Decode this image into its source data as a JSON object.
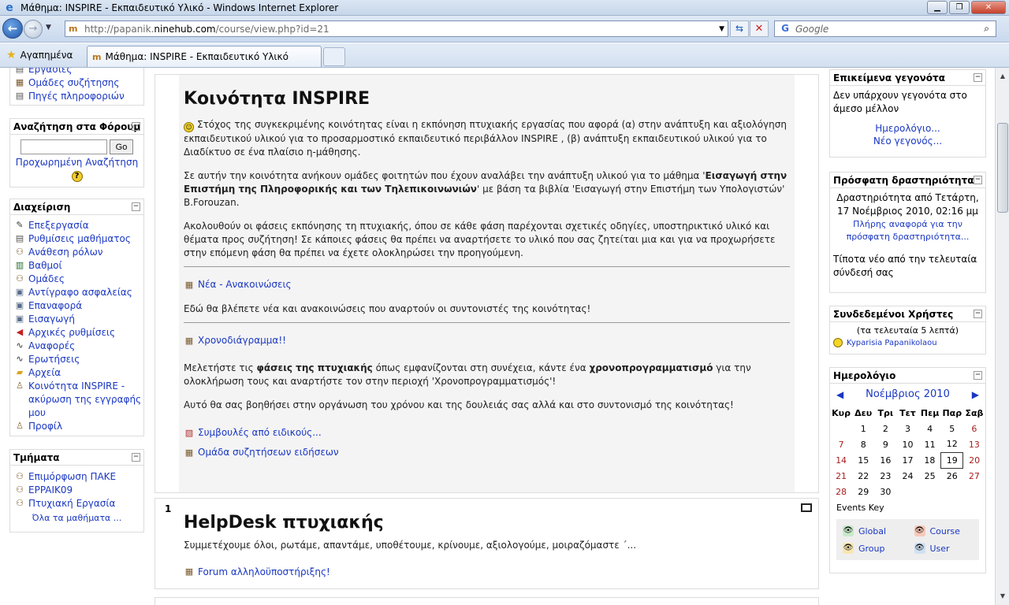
{
  "window": {
    "title": "Μάθημα: INSPIRE - Εκπαιδευτικό Υλικό - Windows Internet Explorer"
  },
  "browser": {
    "url_prefix": "http://papanik.",
    "url_domain": "ninehub.com",
    "url_path": "/course/view.php?id=21",
    "search_placeholder": "Google",
    "favorites_label": "Αγαπημένα",
    "tab_label": "Μάθημα: INSPIRE - Εκπαιδευτικό Υλικό"
  },
  "left": {
    "activities": [
      "Εργασίες",
      "Ομάδες συζήτησης",
      "Πηγές πληροφοριών"
    ],
    "forum_search": {
      "title": "Αναζήτηση στα Φόρουμ",
      "go": "Go",
      "advanced": "Προχωρημένη Αναζήτηση",
      "help": "?"
    },
    "admin": {
      "title": "Διαχείριση",
      "items": [
        {
          "label": "Επεξεργασία",
          "icon": "pencil"
        },
        {
          "label": "Ρυθμίσεις μαθήματος",
          "icon": "doc"
        },
        {
          "label": "Ανάθεση ρόλων",
          "icon": "people"
        },
        {
          "label": "Βαθμοί",
          "icon": "grade"
        },
        {
          "label": "Ομάδες",
          "icon": "people"
        },
        {
          "label": "Αντίγραφο ασφαλείας",
          "icon": "backup"
        },
        {
          "label": "Επαναφορά",
          "icon": "backup"
        },
        {
          "label": "Εισαγωγή",
          "icon": "backup"
        },
        {
          "label": "Αρχικές ρυθμίσεις",
          "icon": "red"
        },
        {
          "label": "Αναφορές",
          "icon": "chart"
        },
        {
          "label": "Ερωτήσεις",
          "icon": "chart"
        },
        {
          "label": "Αρχεία",
          "icon": "folder"
        },
        {
          "label": "Κοινότητα INSPIRE - ακύρωση της εγγραφής μου",
          "icon": "person"
        },
        {
          "label": "Προφίλ",
          "icon": "person"
        }
      ]
    },
    "sections": {
      "title": "Τμήματα",
      "items": [
        "Επιμόρφωση ΠΑΚΕ",
        "EPPAIK09",
        "Πτυχιακή Εργασία"
      ],
      "all": "Όλα τα μαθήματα ..."
    }
  },
  "main": {
    "title": "Κοινότητα INSPIRE",
    "p1": "Στόχος της συγκεκριμένης κοινότητας είναι η εκπόνηση πτυχιακής εργασίας που αφορά (α) στην ανάπτυξη και αξιολόγηση εκπαιδευτικού υλικού για το προσαρμοστικό εκπαιδευτικό περιβάλλον INSPIRE , (β) ανάπτυξη εκπαιδευτικού υλικού για το Διαδίκτυο σε ένα πλαίσιο η-μάθησης.",
    "p2a": "Σε αυτήν την κοινότητα ανήκουν ομάδες φοιτητών που έχουν αναλάβει την ανάπτυξη υλικού για το μάθημα '",
    "p2b": "Εισαγωγή στην Επιστήμη της Πληροφορικής και των Τηλεπικοινωνιών",
    "p2c": "' με βάση τα βιβλία 'Εισαγωγή στην Επιστήμη των Υπολογιστών' Β.Forouzan.",
    "p3": "Ακολουθούν οι φάσεις εκπόνησης τη πτυχιακής, όπου σε κάθε φάση παρέχονται σχετικές οδηγίες, υποστηρικτικό υλικό και θέματα προς συζήτηση! Σε κάποιες φάσεις θα πρέπει να αναρτήσετε το υλικό που σας ζητείται μια και για να προχωρήσετε στην επόμενη φάση θα πρέπει να έχετε ολοκληρώσει την προηγούμενη.",
    "news_link": "Νέα - Ανακοινώσεις",
    "news_text": "Εδώ θα βλέπετε νέα και ανακοινώσεις που αναρτούν οι συντονιστές της κοινότητας!",
    "schedule_link": "Χρονοδιάγραμμα!!",
    "s1a": "Μελετήστε τις ",
    "s1b": "φάσεις της πτυχιακής",
    "s1c": " όπως εμφανίζονται στη συνέχεια, κάντε ένα ",
    "s1d": "χρονοπρογραμματισμό",
    "s1e": " για την ολοκλήρωση τους και αναρτήστε τον στην περιοχή 'Χρονοπρογραμματισμός'!",
    "s2": "Αυτό θα σας βοηθήσει στην οργάνωση του χρόνου και της δουλειάς σας αλλά και στο συντονισμό της κοινότητας!",
    "advice_link": "Συμβουλές από ειδικούς...",
    "group_link": "Ομάδα συζητήσεων ειδήσεων"
  },
  "section1": {
    "num": "1",
    "title": "HelpDesk πτυχιακής",
    "text": "Συμμετέχουμε όλοι, ρωτάμε, απαντάμε, υποθέτουμε, κρίνουμε, αξιολογούμε, μοιραζόμαστε ΄...",
    "forum_link": "Forum αλληλοϋποστήριξης!"
  },
  "right": {
    "upcoming": {
      "title": "Επικείμενα γεγονότα",
      "text": "Δεν υπάρχουν γεγονότα στο άμεσο μέλλον",
      "cal_link": "Ημερολόγιο...",
      "new_link": "Νέο γεγονός..."
    },
    "recent": {
      "title": "Πρόσφατη δραστηριότητα",
      "since": "Δραστηριότητα από Τετάρτη, 17 Νοέμβριος 2010, 02:16 μμ",
      "full_link": "Πλήρης αναφορά για την πρόσφατη δραστηριότητα...",
      "none": "Τίποτα νέο από την τελευταία σύνδεσή σας"
    },
    "online": {
      "title": "Συνδεδεμένοι Χρήστες",
      "sub": "(τα τελευταία 5 λεπτά)",
      "user": "Kyparisia Papanikolaou"
    },
    "calendar": {
      "title": "Ημερολόγιο",
      "month": "Νοέμβριος 2010",
      "days": [
        "Κυρ",
        "Δευ",
        "Τρι",
        "Τετ",
        "Πεμ",
        "Παρ",
        "Σαβ"
      ],
      "weeks": [
        [
          "",
          "1",
          "2",
          "3",
          "4",
          "5",
          "6"
        ],
        [
          "7",
          "8",
          "9",
          "10",
          "11",
          "12",
          "13"
        ],
        [
          "14",
          "15",
          "16",
          "17",
          "18",
          "19",
          "20"
        ],
        [
          "21",
          "22",
          "23",
          "24",
          "25",
          "26",
          "27"
        ],
        [
          "28",
          "29",
          "30",
          "",
          "",
          "",
          ""
        ]
      ],
      "today": "19",
      "events_key": "Events Key",
      "keys": [
        {
          "label": "Global",
          "color": "#c9e9c9"
        },
        {
          "label": "Course",
          "color": "#f7c9b9"
        },
        {
          "label": "Group",
          "color": "#f7e6b0"
        },
        {
          "label": "User",
          "color": "#cfe0f3"
        }
      ]
    }
  },
  "icons": {
    "ie": "e",
    "moodle": "m",
    "back": "←",
    "forward": "→",
    "refresh": "⇆",
    "stop": "✕",
    "star": "★",
    "search": "⌕"
  }
}
